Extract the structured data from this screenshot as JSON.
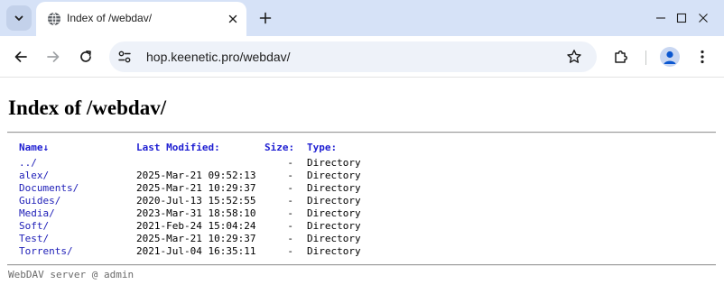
{
  "browser": {
    "tab_title": "Index of /webdav/",
    "url": "hop.keenetic.pro/webdav/"
  },
  "page": {
    "title": "Index of /webdav/",
    "columns": {
      "name": "Name↓",
      "modified": "Last Modified:",
      "size": "Size:",
      "type": "Type:"
    },
    "entries": [
      {
        "name": "../",
        "modified": "",
        "size": "-",
        "type": "Directory"
      },
      {
        "name": "alex/",
        "modified": "2025-Mar-21 09:52:13",
        "size": "-",
        "type": "Directory"
      },
      {
        "name": "Documents/",
        "modified": "2025-Mar-21 10:29:37",
        "size": "-",
        "type": "Directory"
      },
      {
        "name": "Guides/",
        "modified": "2020-Jul-13 15:52:55",
        "size": "-",
        "type": "Directory"
      },
      {
        "name": "Media/",
        "modified": "2023-Mar-31 18:58:10",
        "size": "-",
        "type": "Directory"
      },
      {
        "name": "Soft/",
        "modified": "2021-Feb-24 15:04:24",
        "size": "-",
        "type": "Directory"
      },
      {
        "name": "Test/",
        "modified": "2025-Mar-21 10:29:37",
        "size": "-",
        "type": "Directory"
      },
      {
        "name": "Torrents/",
        "modified": "2021-Jul-04 16:35:11",
        "size": "-",
        "type": "Directory"
      }
    ],
    "footer": "WebDAV server @ admin"
  },
  "colors": {
    "tabstrip": "#d6e2f7",
    "link": "#2020b8",
    "header_link": "#1e1ed2"
  }
}
